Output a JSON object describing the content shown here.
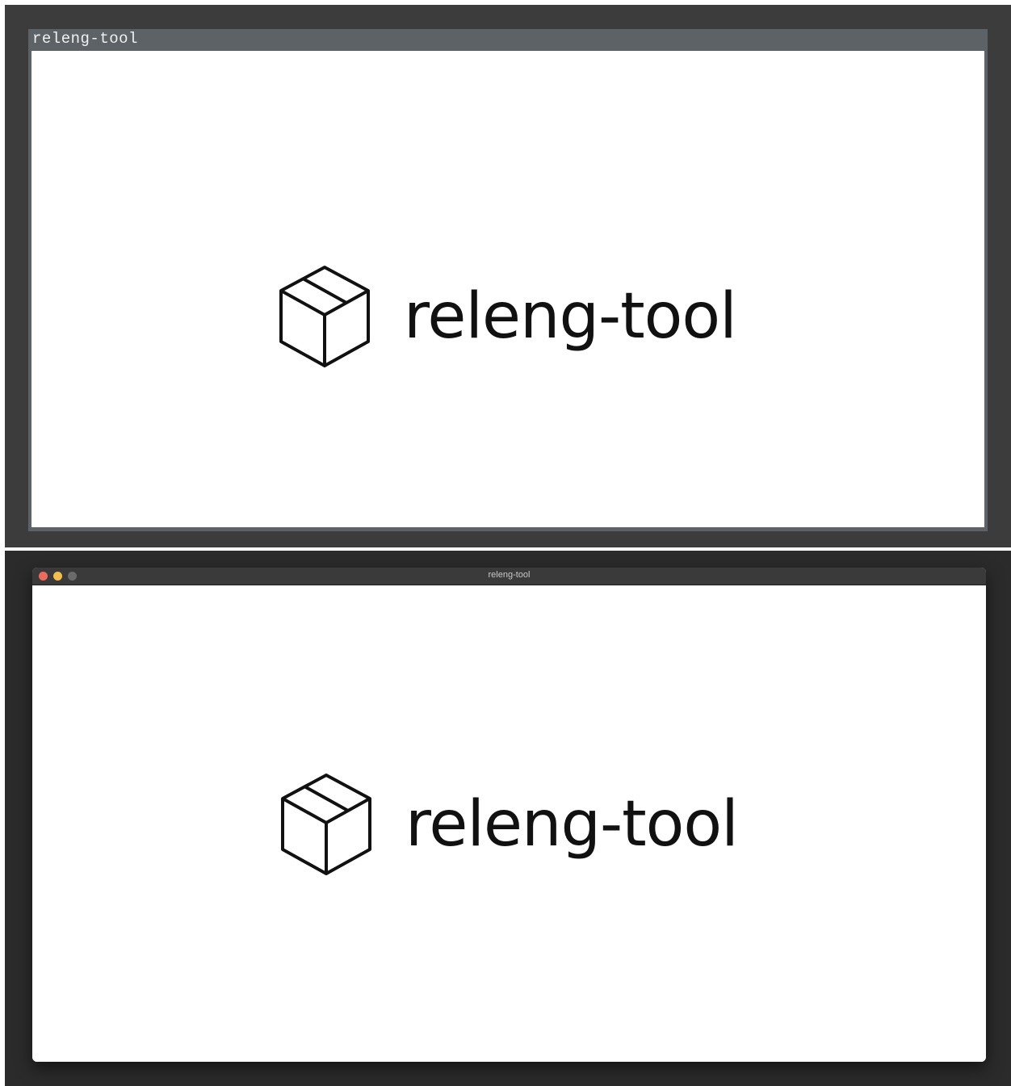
{
  "window_x11": {
    "title": "releng-tool"
  },
  "window_mac": {
    "title": "releng-tool"
  },
  "logo": {
    "text": "releng-tool",
    "icon": "package-box-icon"
  },
  "colors": {
    "x11_frame": "#5d6266",
    "mac_close": "#ed6a5e",
    "mac_minimize": "#f4bf4f",
    "mac_zoom": "#6b6b6b"
  }
}
